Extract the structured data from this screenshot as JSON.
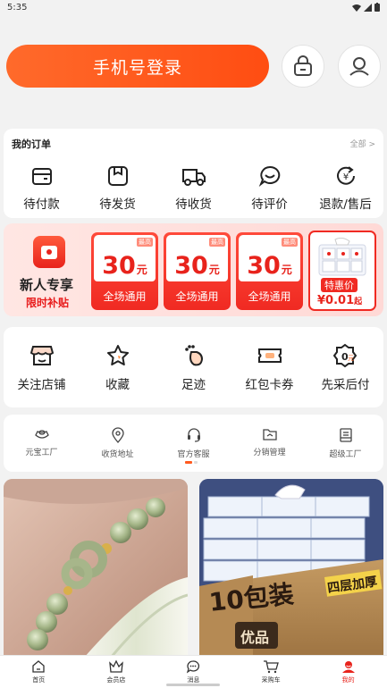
{
  "status": {
    "time": "5:35"
  },
  "header": {
    "login_label": "手机号登录",
    "bag_icon": "shopping-bag-icon",
    "avatar_icon": "user-avatar-icon"
  },
  "orders": {
    "title": "我的订单",
    "all_label": "全部 >",
    "items": [
      {
        "label": "待付款",
        "icon": "wallet-icon"
      },
      {
        "label": "待发货",
        "icon": "package-icon"
      },
      {
        "label": "待收货",
        "icon": "truck-icon"
      },
      {
        "label": "待评价",
        "icon": "comment-icon"
      },
      {
        "label": "退款/售后",
        "icon": "refund-icon"
      }
    ]
  },
  "new_user": {
    "title": "新人专享",
    "subtitle": "限时补贴",
    "coupons": [
      {
        "amount": "30",
        "unit": "元",
        "tag": "最高",
        "scope": "全场通用"
      },
      {
        "amount": "30",
        "unit": "元",
        "tag": "最高",
        "scope": "全场通用"
      },
      {
        "amount": "30",
        "unit": "元",
        "tag": "最高",
        "scope": "全场通用"
      }
    ],
    "deal": {
      "badge": "特惠价",
      "price": "¥0.01",
      "price_suffix": "起"
    }
  },
  "services": [
    {
      "label": "关注店铺",
      "icon": "store-icon"
    },
    {
      "label": "收藏",
      "icon": "star-icon"
    },
    {
      "label": "足迹",
      "icon": "footprint-icon"
    },
    {
      "label": "红包卡券",
      "icon": "coupon-icon"
    },
    {
      "label": "先采后付",
      "icon": "pay-later-icon"
    }
  ],
  "tools": [
    {
      "label": "元宝工厂",
      "icon": "ingot-icon"
    },
    {
      "label": "收货地址",
      "icon": "location-icon"
    },
    {
      "label": "官方客服",
      "icon": "headset-icon"
    },
    {
      "label": "分销管理",
      "icon": "folder-icon"
    },
    {
      "label": "超级工厂",
      "icon": "factory-icon"
    }
  ],
  "products": {
    "left": {
      "icon": "jade-bracelet-image"
    },
    "right": {
      "icon": "tissue-box-image",
      "big_text": "10包装",
      "side_text": "四层加厚",
      "box_text": "优品"
    }
  },
  "tabbar": [
    {
      "label": "首页",
      "icon": "home-icon",
      "active": false
    },
    {
      "label": "会员店",
      "icon": "member-store-icon",
      "active": false
    },
    {
      "label": "消息",
      "icon": "message-icon",
      "active": false
    },
    {
      "label": "采购车",
      "icon": "cart-icon",
      "active": false
    },
    {
      "label": "我的",
      "icon": "profile-icon",
      "active": true
    }
  ],
  "colors": {
    "accent": "#ff5a1f",
    "red": "#e8231c"
  }
}
